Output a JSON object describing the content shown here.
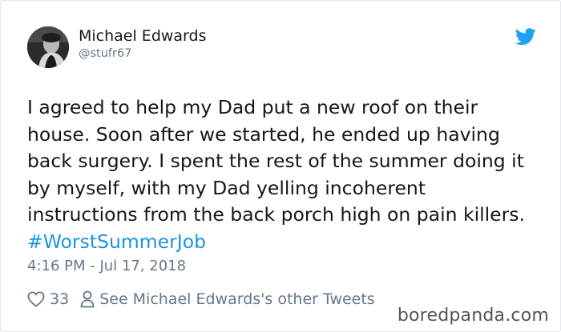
{
  "author": {
    "display_name": "Michael Edwards",
    "handle": "@stufr67"
  },
  "tweet": {
    "lines": [
      "I agreed to help my Dad put a new roof on their",
      "house. Soon after we started, he ended up having",
      "back surgery. I spent the rest of the summer doing it",
      "by myself, with my Dad yelling incoherent",
      "instructions from the back porch high on pain killers."
    ],
    "hashtag": "#WorstSummerJob",
    "timestamp": "4:16 PM - Jul 17, 2018"
  },
  "actions": {
    "like_count": "33",
    "other_tweets_label": "See Michael Edwards's other Tweets"
  },
  "watermark": "boredpanda.com",
  "colors": {
    "link": "#1b95e0",
    "secondary_text": "#657786",
    "primary_text": "#14171a",
    "twitter_blue": "#1da1f2"
  },
  "icons": [
    "twitter-bird-icon",
    "heart-icon",
    "person-icon"
  ]
}
